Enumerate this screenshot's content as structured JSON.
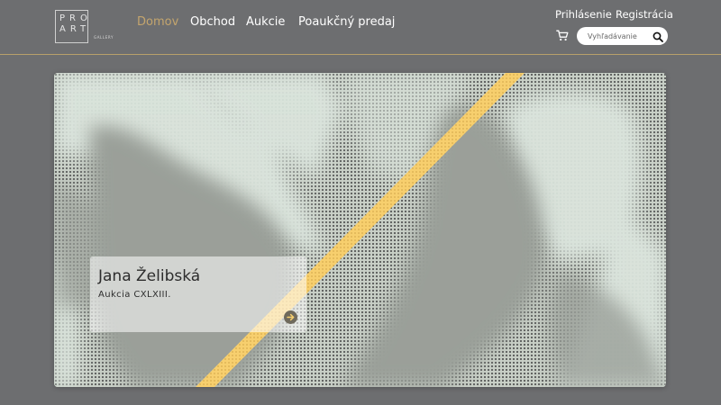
{
  "brand": {
    "logo_text": "PRO ART",
    "logo_sub": "GALLERY"
  },
  "nav": {
    "items": [
      {
        "label": "Domov",
        "active": true
      },
      {
        "label": "Obchod",
        "active": false
      },
      {
        "label": "Aukcie",
        "active": false
      },
      {
        "label": "Poaukčný predaj",
        "active": false
      }
    ]
  },
  "account": {
    "login_label": "Prihlásenie",
    "register_label": "Registrácia"
  },
  "search": {
    "placeholder": "Vyhľadávanie",
    "value": ""
  },
  "icons": {
    "cart": "cart-icon",
    "search": "search-icon",
    "caption_arrow": "arrow-right-circle-icon"
  },
  "hero": {
    "title": "Jana Želibská",
    "subtitle": "Aukcia CXLXIII."
  },
  "colors": {
    "background": "#6d6e70",
    "accent": "#c4a56d",
    "stripe": "#f7cf6e",
    "header_line": "#b8a06a"
  }
}
